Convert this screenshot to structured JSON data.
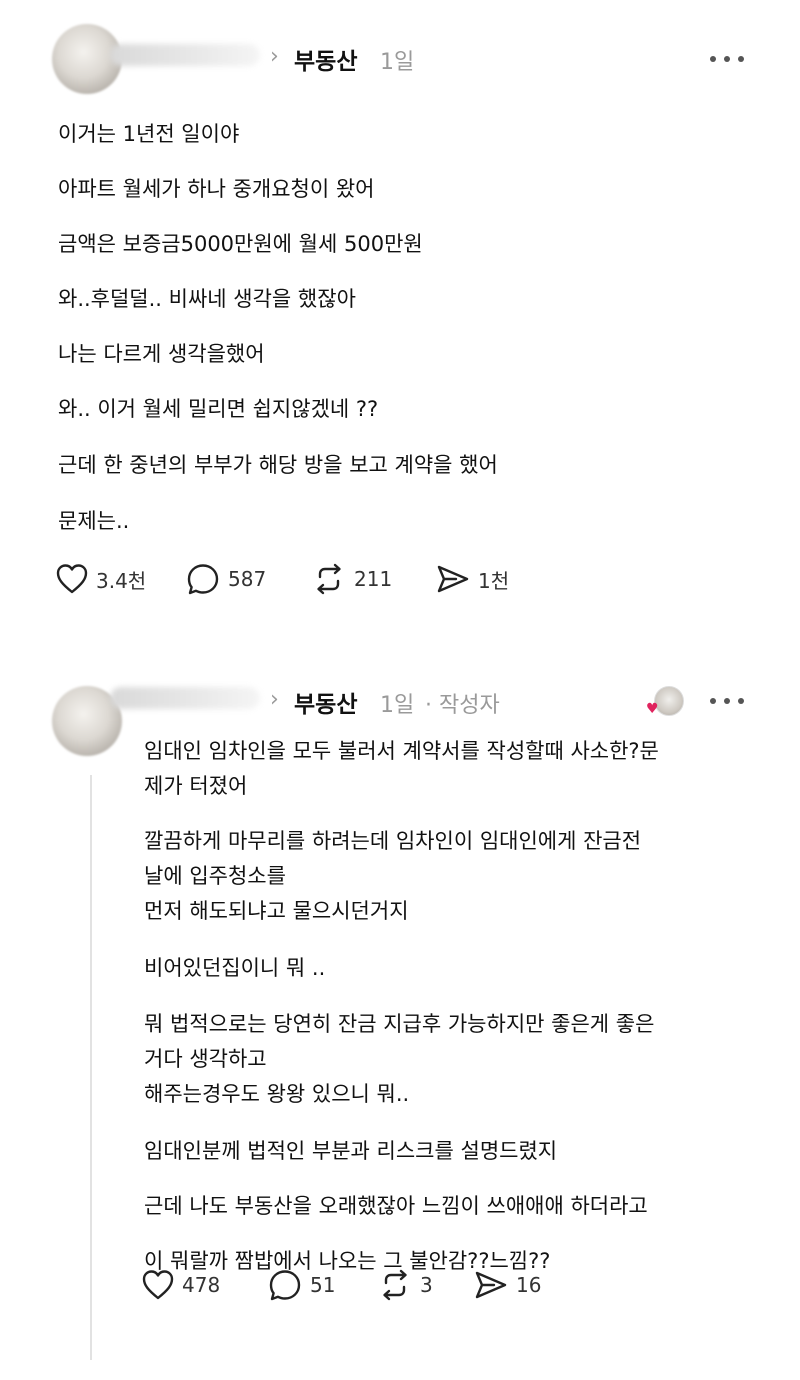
{
  "post1": {
    "category": "부동산",
    "time": "1일",
    "lines": [
      "이거는 1년전 일이야",
      "아파트 월세가 하나 중개요청이 왔어",
      "금액은 보증금5000만원에 월세 500만원",
      "와..후덜덜.. 비싸네 생각을 했잖아",
      "나는 다르게 생각을했어",
      "와.. 이거 월세 밀리면 쉽지않겠네 ??",
      "근데 한 중년의 부부가 해당 방을 보고 계약을 했어",
      "문제는.."
    ],
    "actions": {
      "likes": "3.4천",
      "comments": "587",
      "reposts": "211",
      "shares": "1천"
    }
  },
  "post2": {
    "category": "부동산",
    "time": "1일",
    "author_tag": "· 작성자",
    "lines": [
      "임대인 임차인을 모두 불러서 계약서를 작성할때 사소한?문",
      "제가 터졌어",
      "깔끔하게 마무리를 하려는데 임차인이 임대인에게 잔금전",
      "날에 입주청소를",
      "먼저 해도되냐고 물으시던거지",
      "비어있던집이니 뭐 ..",
      "뭐 법적으로는 당연히 잔금 지급후 가능하지만 좋은게 좋은",
      "거다 생각하고",
      "해주는경우도 왕왕 있으니 뭐..",
      "임대인분께 법적인 부분과 리스크를 설명드렸지",
      "근데 나도 부동산을 오래했잖아 느낌이 쓰애애애 하더라고",
      "이 뭐랄까 짬밥에서 나오는 그 불안감??느낌??"
    ],
    "actions": {
      "likes": "478",
      "comments": "51",
      "reposts": "3",
      "shares": "16"
    }
  },
  "icons": {
    "like": "heart-icon",
    "comment": "speech-bubble-icon",
    "repost": "repost-icon",
    "share": "send-icon",
    "more": "more-dots-icon",
    "chevron": "chevron-right-icon"
  }
}
